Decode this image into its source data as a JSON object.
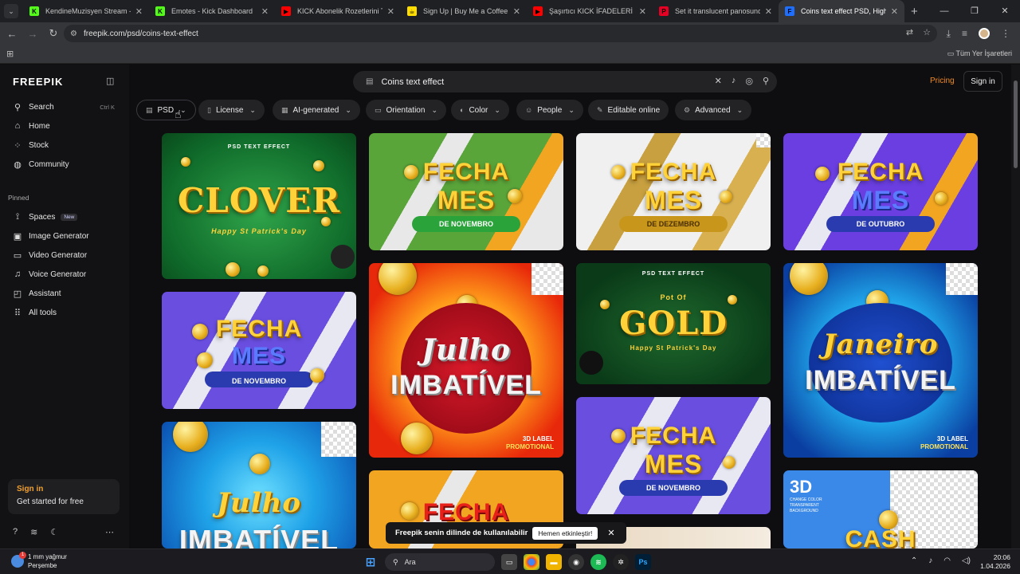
{
  "tabs": [
    {
      "title": "KendineMuzisyen Stream - Wat",
      "favicon_color": "#53fc18",
      "favicon_letter": "K",
      "active": false
    },
    {
      "title": "Emotes - Kick Dashboard",
      "favicon_color": "#53fc18",
      "favicon_letter": "K",
      "active": false
    },
    {
      "title": "KICK Abonelik Rozetlerini Tasarı",
      "favicon_color": "#ff0000",
      "favicon_letter": "▶",
      "active": false
    },
    {
      "title": "Sign Up | Buy Me a Coffee",
      "favicon_color": "#ffdd00",
      "favicon_letter": "☕",
      "active": false
    },
    {
      "title": "Şaşırtıcı KICK İFADELERİ ve GİF",
      "favicon_color": "#ff0000",
      "favicon_letter": "▶",
      "active": false
    },
    {
      "title": "Set it translucent panosundaki",
      "favicon_color": "#e60023",
      "favicon_letter": "P",
      "active": false
    },
    {
      "title": "Coins text effect PSD, High Qu",
      "favicon_color": "#1e6fff",
      "favicon_letter": "F",
      "active": true
    }
  ],
  "address": "freepik.com/psd/coins-text-effect",
  "bookmarks_all": "Tüm Yer İşaretleri",
  "sidebar": {
    "logo": "FREEPIK",
    "search": "Search",
    "search_kbd": "Ctrl K",
    "home": "Home",
    "stock": "Stock",
    "community": "Community",
    "pinned": "Pinned",
    "spaces": "Spaces",
    "spaces_badge": "New",
    "image_generator": "Image Generator",
    "video_generator": "Video Generator",
    "voice_generator": "Voice Generator",
    "assistant": "Assistant",
    "all_tools": "All tools",
    "signin": "Sign in",
    "get_started": "Get started for free"
  },
  "header": {
    "search_value": "Coins text effect",
    "pricing": "Pricing",
    "signin": "Sign in"
  },
  "filters": {
    "psd": "PSD",
    "license": "License",
    "ai": "AI-generated",
    "orientation": "Orientation",
    "color": "Color",
    "people": "People",
    "editable": "Editable online",
    "advanced": "Advanced"
  },
  "cards": {
    "clover": {
      "top": "PSD TEXT EFFECT",
      "main": "CLOVER",
      "sub": "Happy St Patrick's Day"
    },
    "fecha1": {
      "l1": "FECHA",
      "l2": "MES",
      "ribbon": "DE NOVEMBRO"
    },
    "fecha2": {
      "l1": "FECHA",
      "l2": "MES",
      "ribbon": "DE DEZEMBRO"
    },
    "fecha3": {
      "l1": "FECHA",
      "l2": "MES",
      "ribbon": "DE OUTUBRO"
    },
    "fecha4": {
      "l1": "FECHA",
      "l2": "MES",
      "ribbon": "DE NOVEMBRO"
    },
    "julho1": {
      "l1": "Julho",
      "l2": "IMBATÍVEL",
      "label": "3D LABEL",
      "label2": "PROMOTIONAL"
    },
    "gold": {
      "top": "PSD TEXT EFFECT",
      "small": "Pot Of",
      "main": "GOLD",
      "sub": "Happy St Patrick's Day"
    },
    "janeiro": {
      "l1": "Janeiro",
      "l2": "IMBATÍVEL",
      "label": "3D LABEL",
      "label2": "PROMOTIONAL"
    },
    "fecha5": {
      "l1": "FECHA",
      "l2": "MES",
      "ribbon": "DE NOVEMBRO"
    },
    "julho2": {
      "l1": "Julho",
      "l2": "IMBATÍVEL"
    },
    "fecha6": {
      "l1": "FECHA"
    },
    "cash": {
      "big": "3D",
      "sub1": "CHANGE COLOR",
      "sub2": "TRANSPARENT",
      "sub3": "BACKGROUND",
      "main": "CASH"
    }
  },
  "toast": {
    "message": "Freepik senin dilinde de kullanılabilir",
    "button": "Hemen etkinleştir!"
  },
  "taskbar": {
    "weather_temp": "1 mm yağmur",
    "weather_day": "Perşembe",
    "weather_badge": "1",
    "search": "Ara",
    "time": "20:06",
    "date": "1.04.2026"
  }
}
